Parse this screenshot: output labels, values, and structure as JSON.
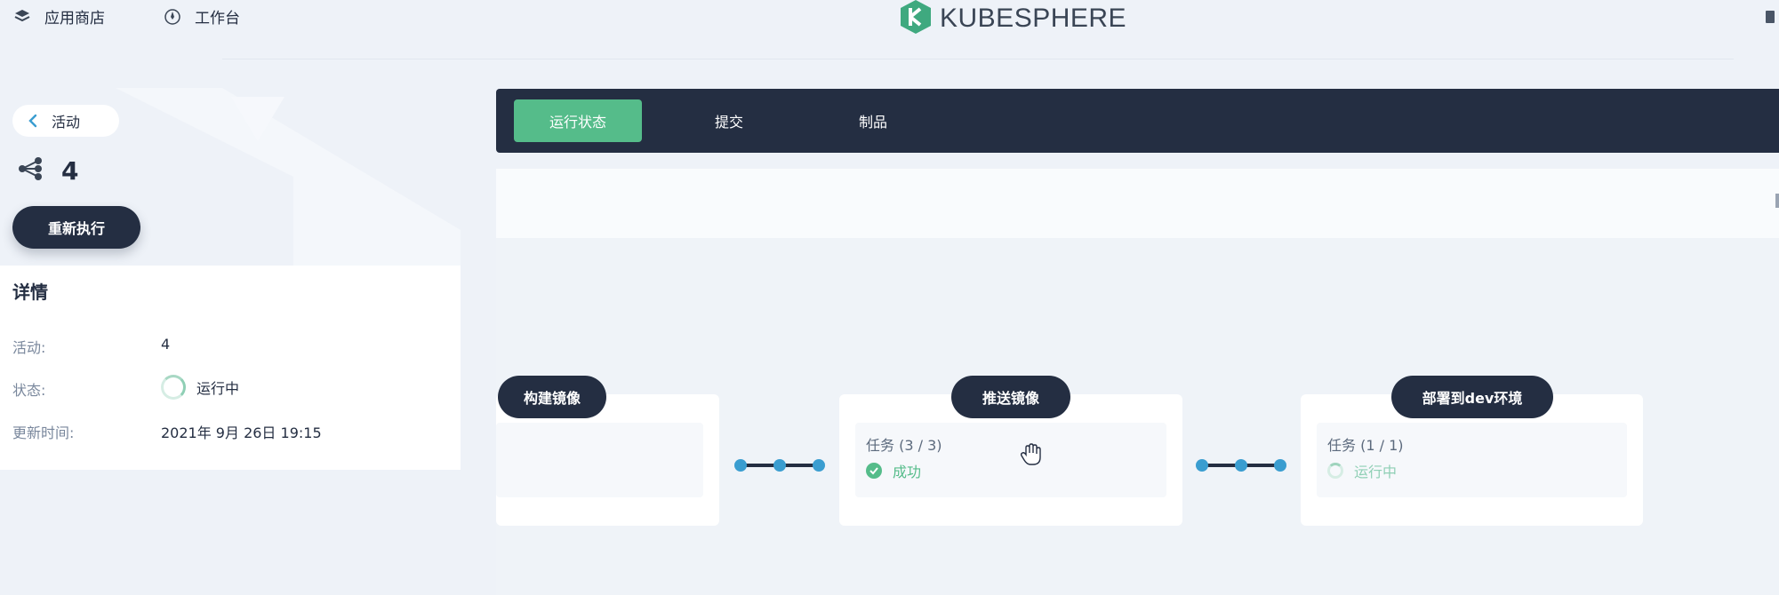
{
  "topbar": {
    "app_store_label": "应用商店",
    "workbench_label": "工作台",
    "logo_text": "KUBESPHERE"
  },
  "left": {
    "back_label": "活动",
    "run_number": "4",
    "rerun_label": "重新执行",
    "details_title": "详情",
    "details": {
      "activity_label": "活动:",
      "activity_value": "4",
      "status_label": "状态:",
      "status_value": "运行中",
      "updated_label": "更新时间:",
      "updated_value": "2021年 9月 26日 19:15"
    }
  },
  "tabs": [
    {
      "label": "运行状态",
      "active": true
    },
    {
      "label": "提交",
      "active": false
    },
    {
      "label": "制品",
      "active": false
    }
  ],
  "stages": [
    {
      "title": "构建镜像",
      "task": "",
      "status": ""
    },
    {
      "title": "推送镜像",
      "task": "任务 (3 / 3)",
      "status": "成功"
    },
    {
      "title": "部署到dev环境",
      "task": "任务 (1 / 1)",
      "status": "运行中"
    }
  ],
  "colors": {
    "dark": "#242e42",
    "accent_green": "#55bc8a",
    "connector_blue": "#3385d6"
  },
  "icons": [
    "layers-icon",
    "compass-icon",
    "kubesphere-logo-icon",
    "chevron-left-icon",
    "pipeline-icon",
    "spinner-icon",
    "check-circle-icon",
    "hand-cursor-icon"
  ]
}
